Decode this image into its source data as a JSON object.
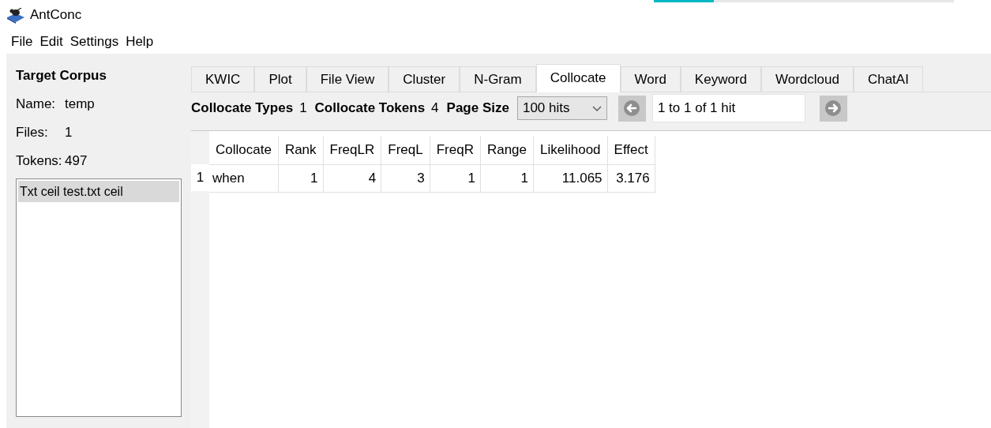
{
  "window": {
    "title": "AntConc"
  },
  "progress": {
    "level": 0.2
  },
  "menu": [
    "File",
    "Edit",
    "Settings",
    "Help"
  ],
  "corpus": {
    "heading": "Target Corpus",
    "fields": [
      {
        "label": "Name:",
        "value": "temp"
      },
      {
        "label": "Files:",
        "value": "1"
      },
      {
        "label": "Tokens:",
        "value": "497"
      }
    ],
    "files": [
      {
        "name": "Txt ceil test.txt ceil",
        "selected": true
      }
    ]
  },
  "tabs": [
    {
      "label": "KWIC",
      "selected": false
    },
    {
      "label": "Plot",
      "selected": false
    },
    {
      "label": "File View",
      "selected": false
    },
    {
      "label": "Cluster",
      "selected": false
    },
    {
      "label": "N-Gram",
      "selected": false
    },
    {
      "label": "Collocate",
      "selected": true
    },
    {
      "label": "Word",
      "selected": false
    },
    {
      "label": "Keyword",
      "selected": false
    },
    {
      "label": "Wordcloud",
      "selected": false
    },
    {
      "label": "ChatAI",
      "selected": false
    }
  ],
  "toolbar": {
    "stats": [
      {
        "label": "Collocate Types",
        "value": "1"
      },
      {
        "label": "Collocate Tokens",
        "value": "4"
      }
    ],
    "page_size_label": "Page Size",
    "page_size": "100 hits",
    "hits": "1 to 1 of 1 hit"
  },
  "table": {
    "columns": [
      "Collocate",
      "Rank",
      "FreqLR",
      "FreqL",
      "FreqR",
      "Range",
      "Likelihood",
      "Effect"
    ],
    "rows": [
      {
        "number": "1",
        "cells": [
          "when",
          "1",
          "4",
          "3",
          "1",
          "1",
          "11.065",
          "3.176"
        ]
      }
    ]
  }
}
